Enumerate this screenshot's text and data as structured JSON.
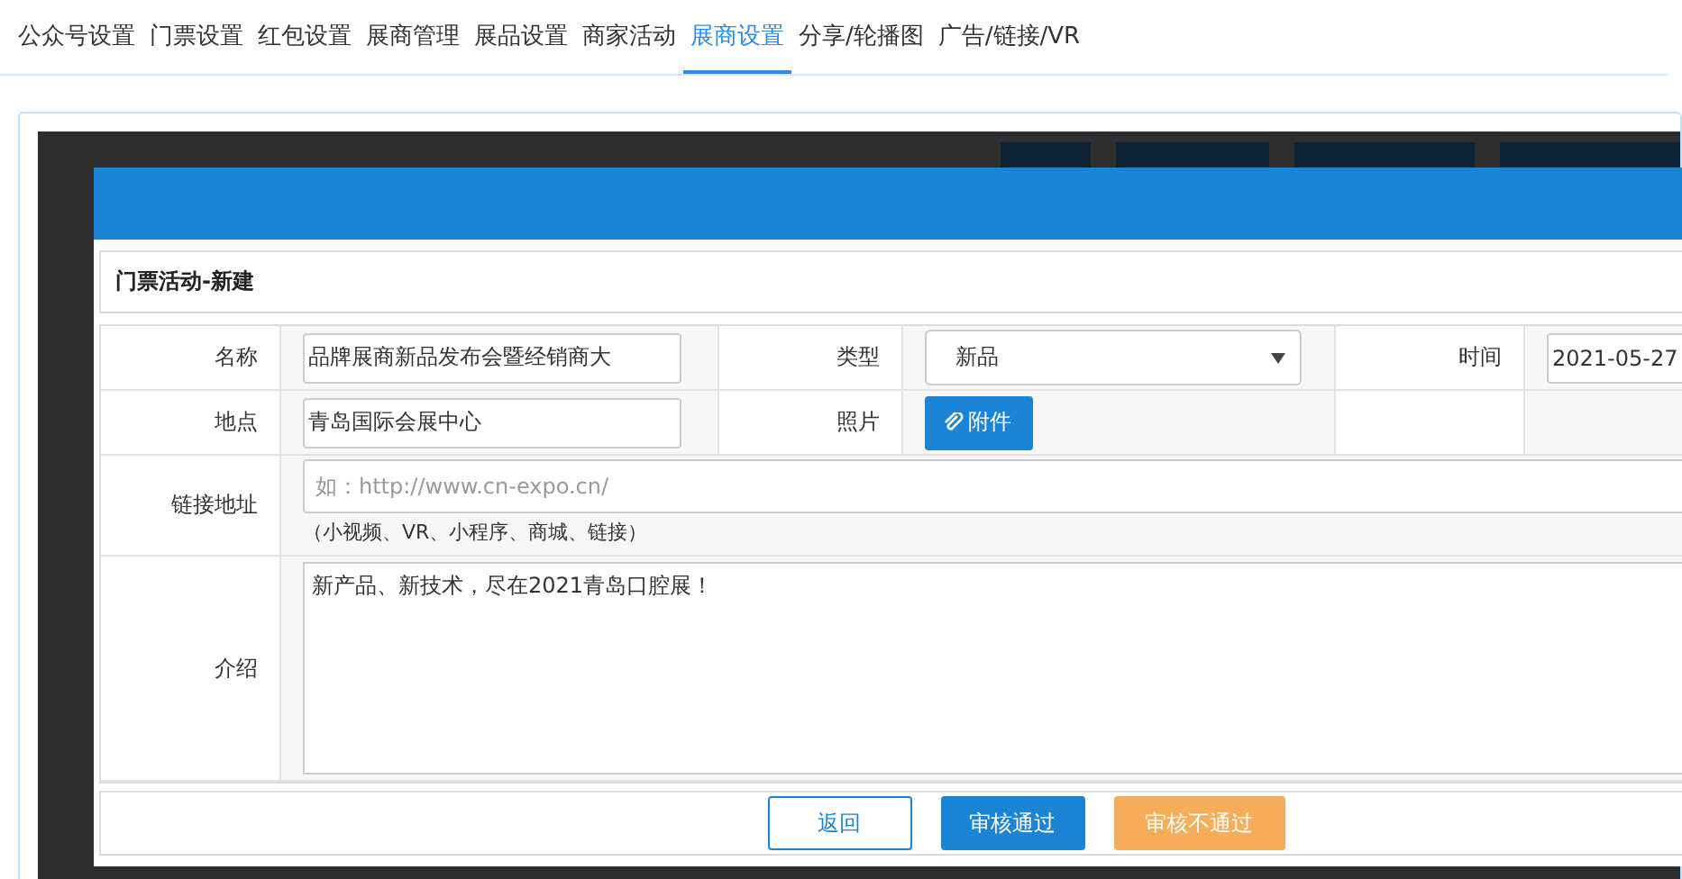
{
  "tabs": [
    {
      "label": "公众号设置",
      "selected": false
    },
    {
      "label": "门票设置",
      "selected": false
    },
    {
      "label": "红包设置",
      "selected": false
    },
    {
      "label": "展商管理",
      "selected": false
    },
    {
      "label": "展品设置",
      "selected": false
    },
    {
      "label": "商家活动",
      "selected": false
    },
    {
      "label": "展商设置",
      "selected": true
    },
    {
      "label": "分享/轮播图",
      "selected": false
    },
    {
      "label": "广告/链接/VR",
      "selected": false
    }
  ],
  "modal": {
    "title": "门票活动-新建",
    "name": {
      "label": "名称",
      "value": "品牌展商新品发布会暨经销商大"
    },
    "type": {
      "label": "类型",
      "value": "新品"
    },
    "time": {
      "label": "时间",
      "value": "2021-05-27"
    },
    "place": {
      "label": "地点",
      "value": "青岛国际会展中心"
    },
    "photo": {
      "label": "照片",
      "button": "附件"
    },
    "link": {
      "label": "链接地址",
      "placeholder": "如：http://www.cn-expo.cn/",
      "hint": "（小视频、VR、小程序、商城、链接）"
    },
    "intro": {
      "label": "介绍",
      "value": "新产品、新技术，尽在2021青岛口腔展！"
    },
    "buttons": [
      {
        "label": "返回",
        "kind": "outline"
      },
      {
        "label": "审核通过",
        "kind": "primary"
      },
      {
        "label": "审核不通过",
        "kind": "warning"
      }
    ]
  }
}
